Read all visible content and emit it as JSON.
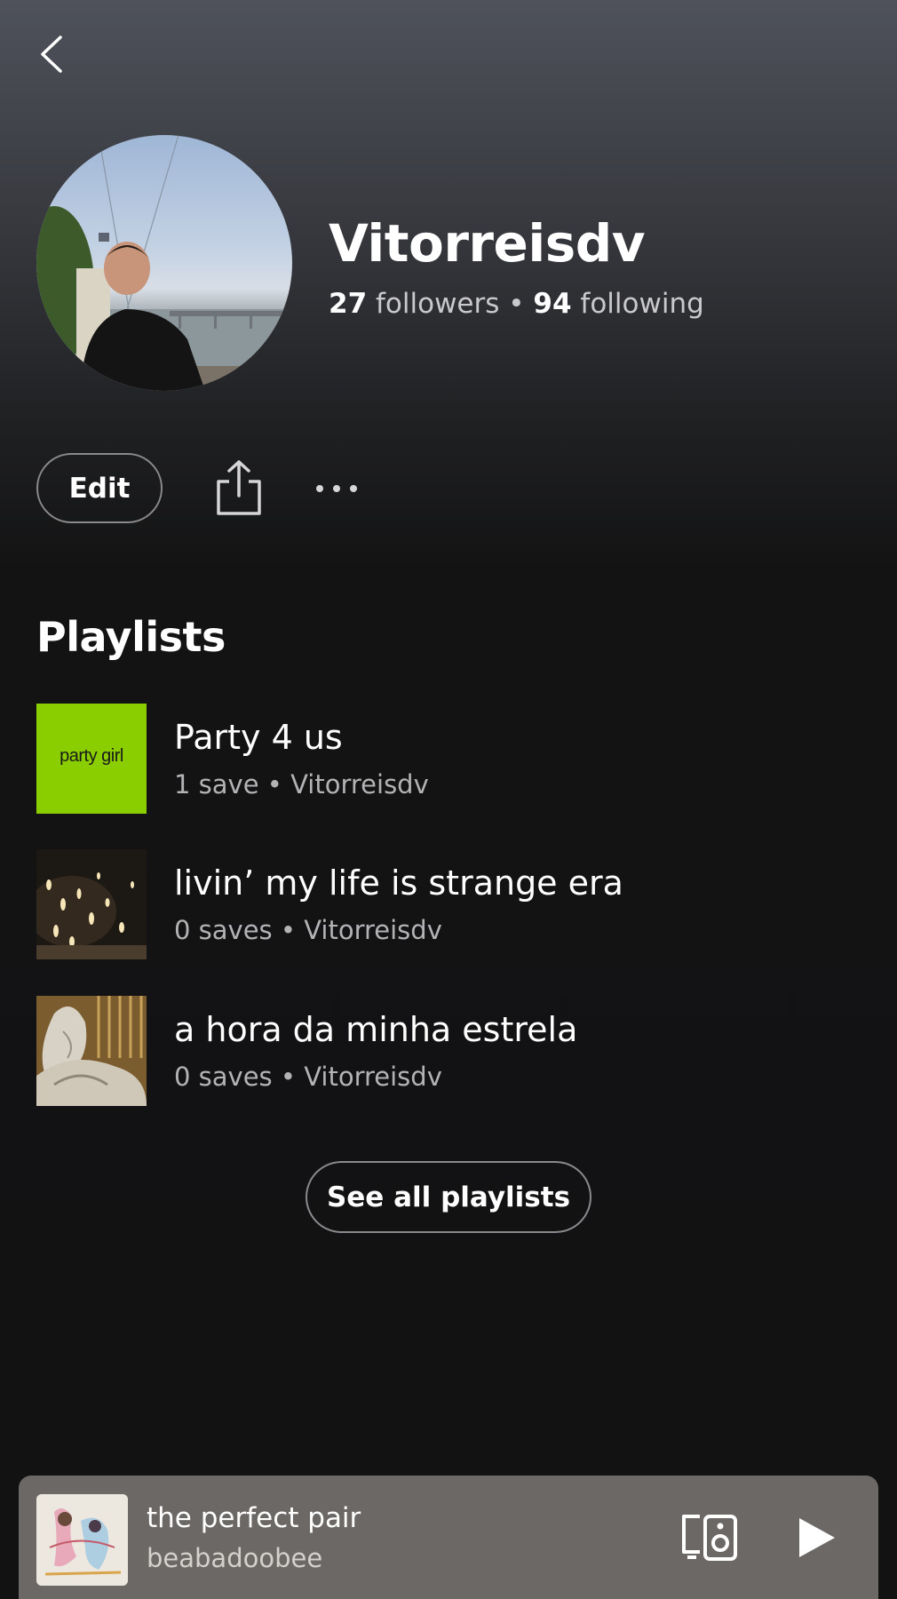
{
  "header": {
    "back_icon": "chevron-left-icon"
  },
  "profile": {
    "name": "Vitorreisdv",
    "followers_count": "27",
    "followers_label": "followers",
    "separator": "•",
    "following_count": "94",
    "following_label": "following"
  },
  "actions": {
    "edit_label": "Edit",
    "share_icon": "share-icon",
    "more_icon": "more-options-icon"
  },
  "playlists": {
    "section_title": "Playlists",
    "items": [
      {
        "title": "Party 4 us",
        "subtitle": "1 save • Vitorreisdv",
        "cover_text": "party girl",
        "cover_color": "#8ace00"
      },
      {
        "title": "livin’ my life is strange era",
        "subtitle": "0 saves • Vitorreisdv"
      },
      {
        "title": "a hora da minha estrela",
        "subtitle": "0 saves • Vitorreisdv"
      }
    ],
    "see_all_label": "See all playlists"
  },
  "now_playing": {
    "title": "the perfect pair",
    "artist": "beabadoobee",
    "device_icon": "connect-device-icon",
    "play_icon": "play-icon"
  }
}
